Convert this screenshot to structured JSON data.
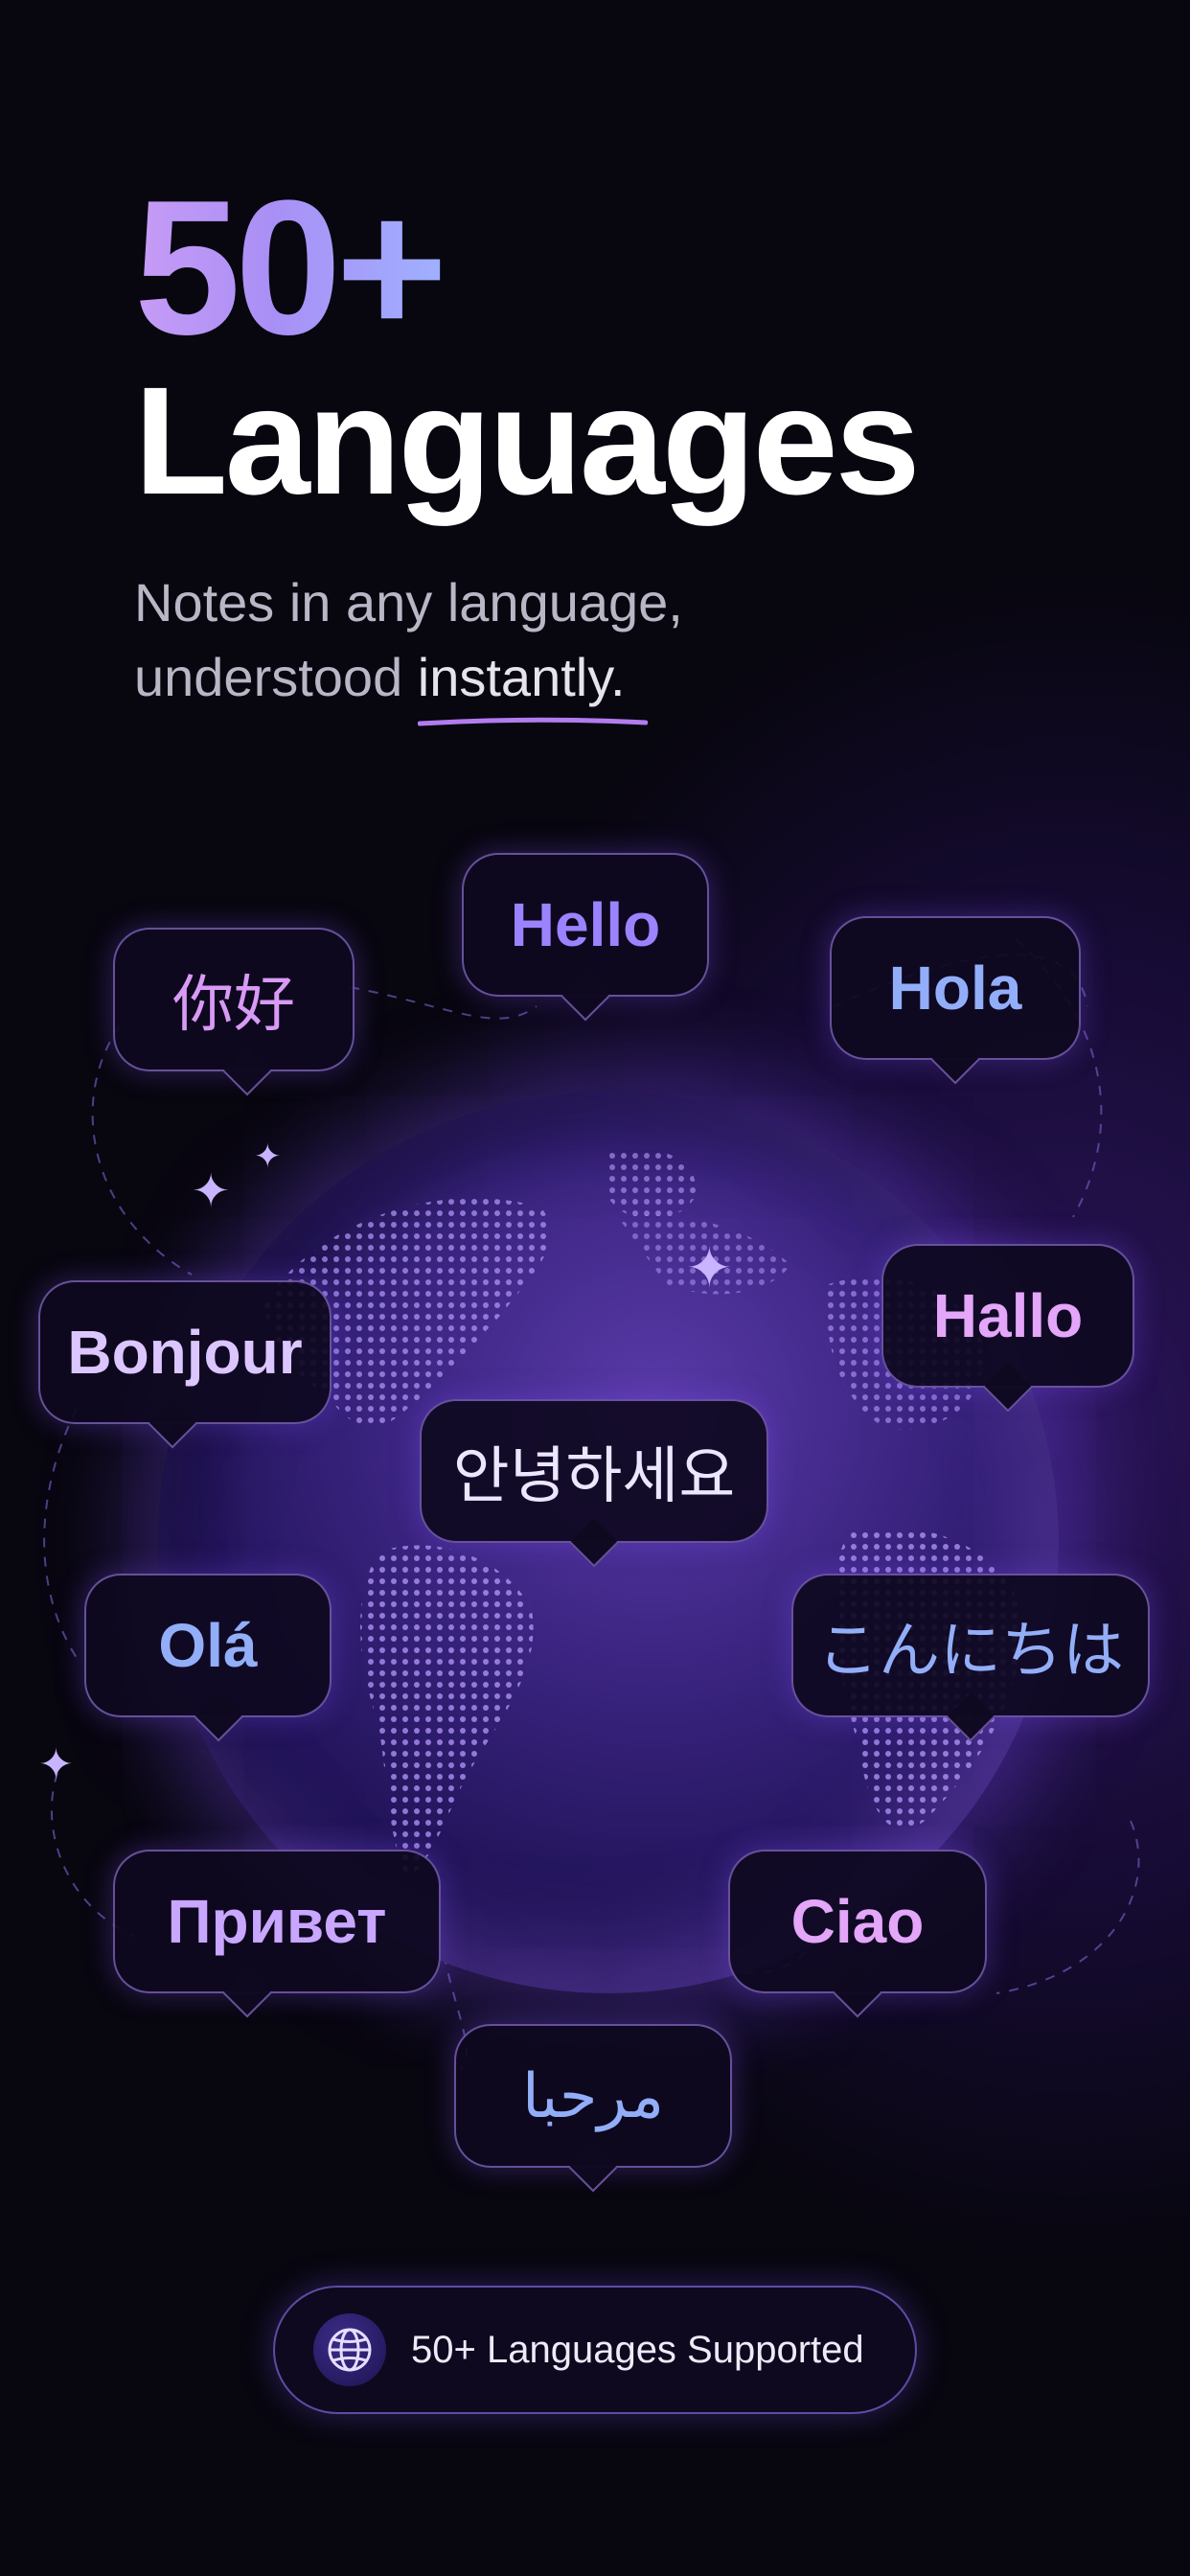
{
  "header": {
    "title_number": "50+",
    "title_word": "Languages",
    "subtitle_line1": "Notes in any language,",
    "subtitle_line2_prefix": "understood ",
    "subtitle_highlight": "instantly."
  },
  "bubbles": [
    {
      "text": "你好",
      "color": "#d89af5"
    },
    {
      "text": "Hello",
      "color": "#9b83ff"
    },
    {
      "text": "Hola",
      "color": "#93aef8"
    },
    {
      "text": "Bonjour",
      "color": "#dcc6ff"
    },
    {
      "text": "Hallo",
      "color": "#e4a6f8"
    },
    {
      "text": "안녕하세요",
      "color": "#ece6ff"
    },
    {
      "text": "Olá",
      "color": "#93aef8"
    },
    {
      "text": "こんにちは",
      "color": "#93aef8"
    },
    {
      "text": "Привет",
      "color": "#c9a6ff"
    },
    {
      "text": "Ciao",
      "color": "#e4a6f8"
    },
    {
      "text": "مرحبا",
      "color": "#93aef8"
    }
  ],
  "badge": {
    "icon": "globe-icon",
    "label": "50+ Languages Supported"
  },
  "colors": {
    "background": "#08060f",
    "accent": "#9b83ff",
    "globe": "#3a2480"
  }
}
